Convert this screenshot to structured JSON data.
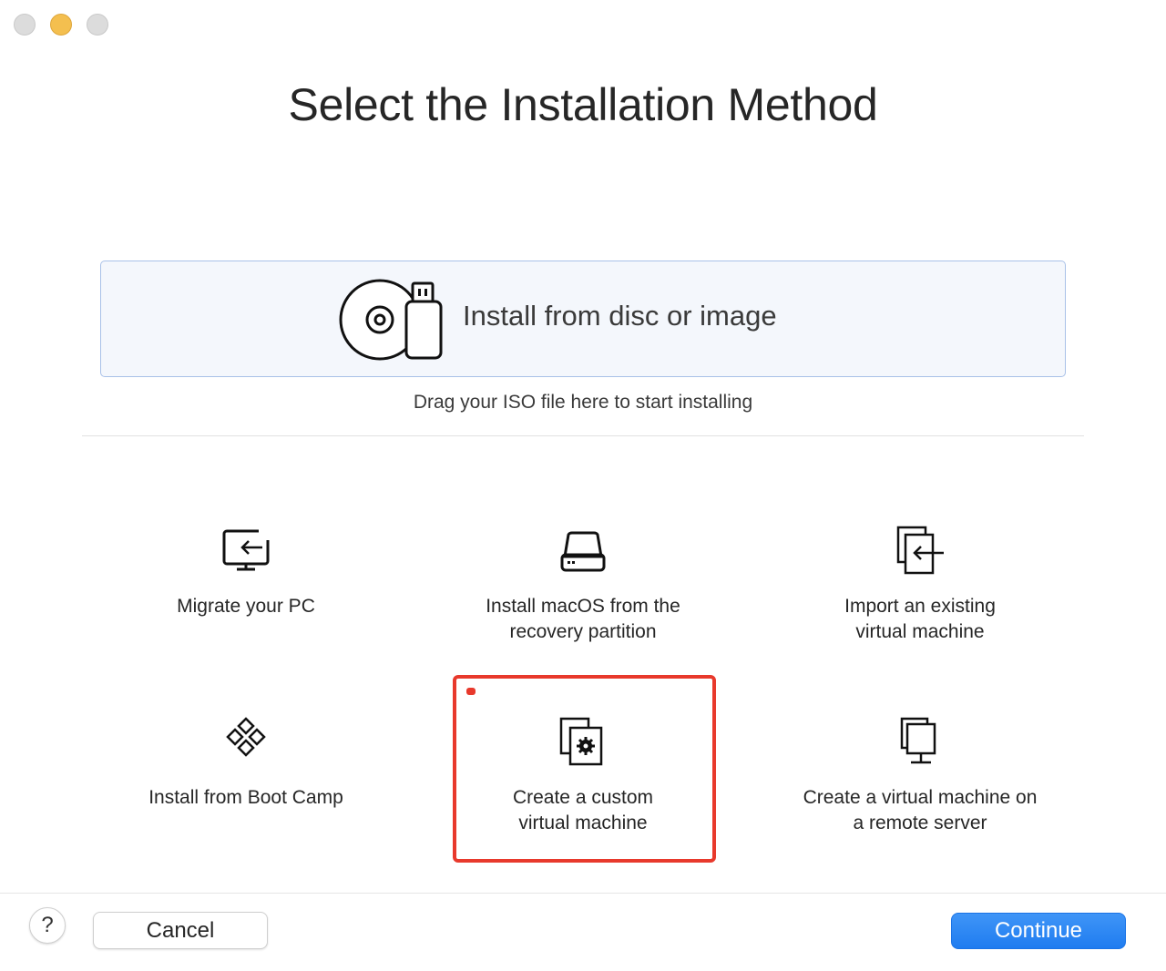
{
  "window": {
    "controls": [
      "close",
      "minimize",
      "zoom"
    ]
  },
  "title": "Select the Installation Method",
  "dropzone": {
    "label": "Install from disc or image",
    "icon": "disc-and-usb-icon",
    "hint": "Drag your ISO file here to start installing"
  },
  "options": [
    {
      "label": "Migrate your PC",
      "icon": "migrate-pc-icon"
    },
    {
      "label": "Install macOS from the recovery partition",
      "icon": "hard-drive-icon"
    },
    {
      "label": "Import an existing virtual machine",
      "icon": "import-vm-icon"
    },
    {
      "label": "Install from Boot Camp",
      "icon": "boot-camp-icon"
    },
    {
      "label": "Create a custom virtual machine",
      "icon": "custom-vm-gear-icon",
      "highlighted": true
    },
    {
      "label": "Create a virtual machine on a remote server",
      "icon": "remote-server-icon"
    }
  ],
  "footer": {
    "help_label": "?",
    "cancel_label": "Cancel",
    "continue_label": "Continue"
  },
  "colors": {
    "accent": "#1f7cf0",
    "highlight": "#e8392c",
    "dropzone_bg": "#f4f7fc",
    "dropzone_border": "#a9c1e8",
    "minimize": "#f4bf4f"
  }
}
